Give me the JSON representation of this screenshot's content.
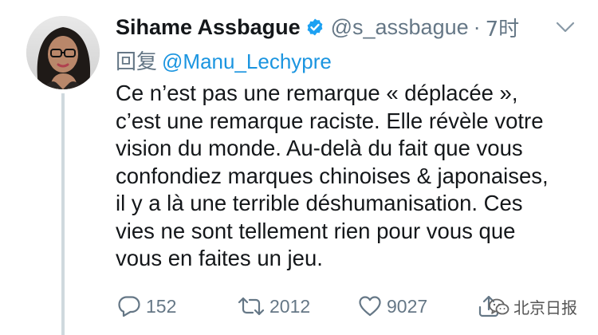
{
  "tweet": {
    "display_name": "Sihame Assbague",
    "verified": true,
    "handle": "@s_assbague",
    "separator": "·",
    "time": "7时",
    "reply_label": "回复",
    "reply_user": "@Manu_Lechypre",
    "body_lines": [
      "Ce n’est pas une remarque « déplacée »,",
      "c’est une remarque raciste. Elle révèle votre",
      "vision du monde. Au-delà du fait que vous",
      "confondiez marques chinoises & japonaises,",
      "il y a là une terrible déshumanisation. Ces",
      "vies ne sont tellement rien pour vous que",
      "vous en faites un jeu."
    ],
    "counts": {
      "replies": "152",
      "retweets": "2012",
      "likes": "9027"
    }
  },
  "watermark": {
    "text": "北京日报"
  },
  "colors": {
    "text": "#14171a",
    "muted": "#657786",
    "link": "#1b95e0",
    "verified": "#1da1f2",
    "thread_line": "#cfd9de"
  },
  "icons": {
    "verified": "verified-badge-icon",
    "caret": "chevron-down-icon",
    "reply": "reply-bubble-icon",
    "retweet": "retweet-icon",
    "like": "heart-icon",
    "share": "share-icon",
    "watermark": "wechat-logo-icon"
  }
}
